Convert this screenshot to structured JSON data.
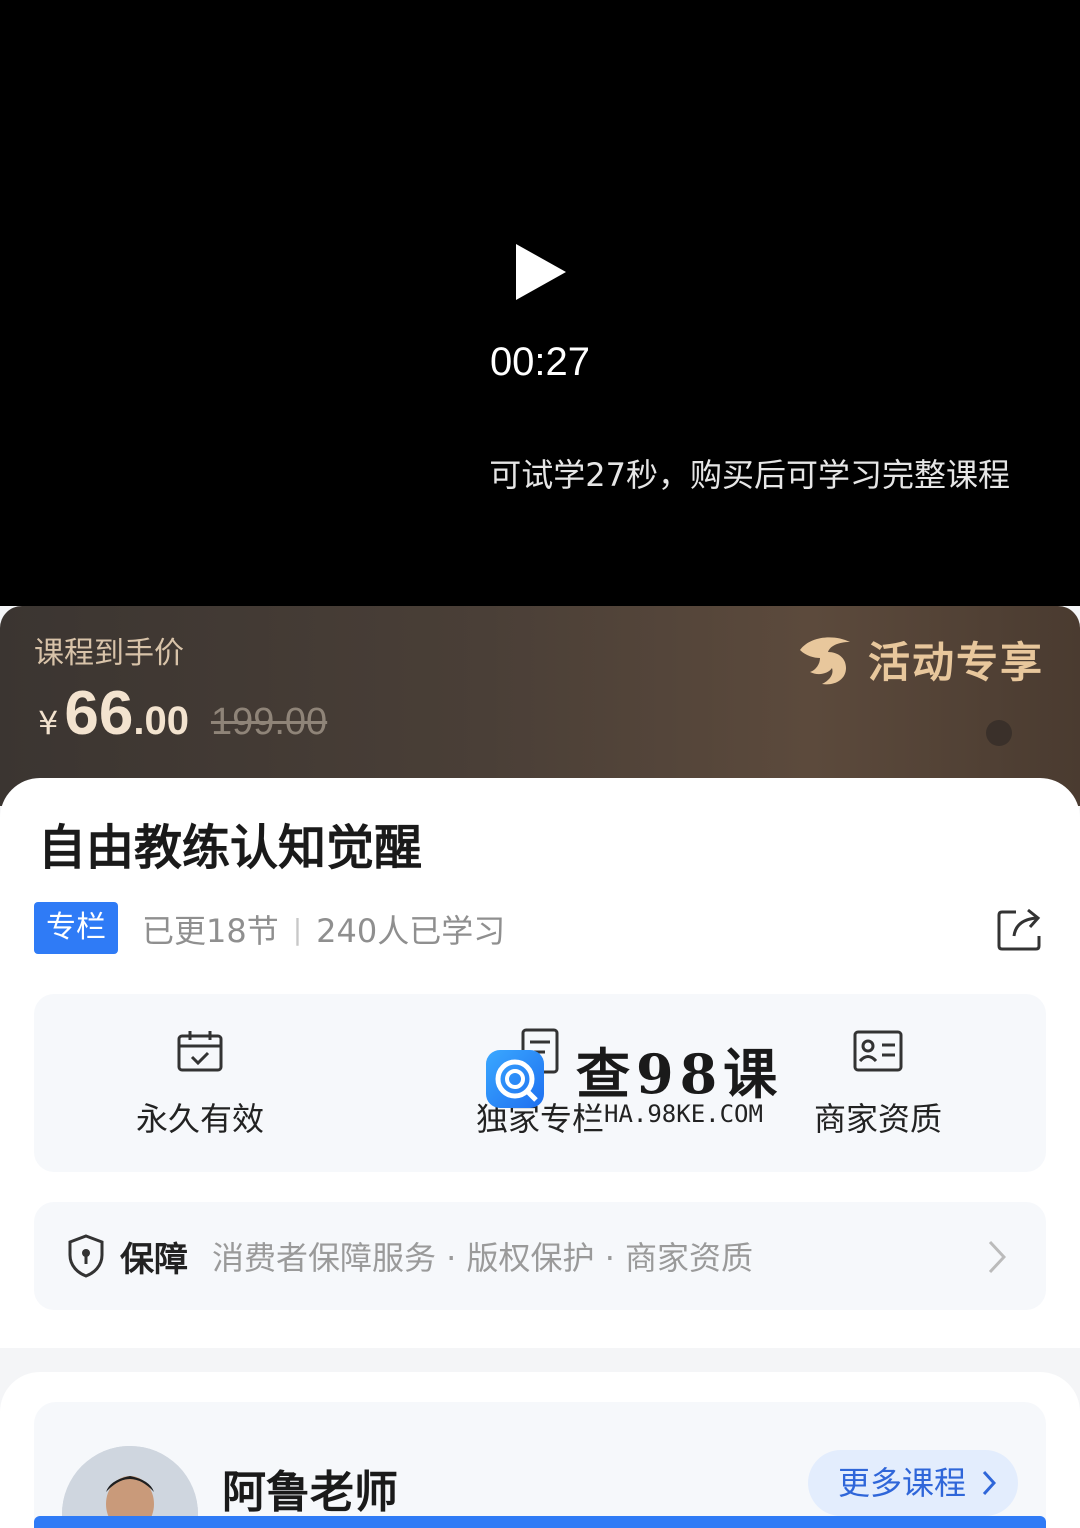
{
  "video": {
    "time": "00:27",
    "trial_hint": "可试学27秒，购买后可学习完整课程"
  },
  "price": {
    "label": "课程到手价",
    "currency": "¥",
    "integer": "66",
    "decimal": ".00",
    "original": "199.00",
    "promo_text": "活动专享"
  },
  "course": {
    "title": "自由教练认知觉醒",
    "tag": "专栏",
    "updates": "已更18节",
    "learners": "240人已学习"
  },
  "features": [
    {
      "label": "永久有效",
      "icon": "calendar-check-icon"
    },
    {
      "label": "独家专栏",
      "icon": "document-icon"
    },
    {
      "label": "商家资质",
      "icon": "id-card-icon"
    }
  ],
  "watermark": {
    "title": "查98课",
    "url": "HA.98KE.COM"
  },
  "guarantee": {
    "title": "保障",
    "items": "消费者保障服务 · 版权保护 · 商家资质"
  },
  "teacher": {
    "name": "阿鲁老师",
    "more_label": "更多课程"
  },
  "colors": {
    "accent": "#2f7bf6",
    "price_gold": "#f3e3cf",
    "promo_gold": "#e8c79c"
  }
}
